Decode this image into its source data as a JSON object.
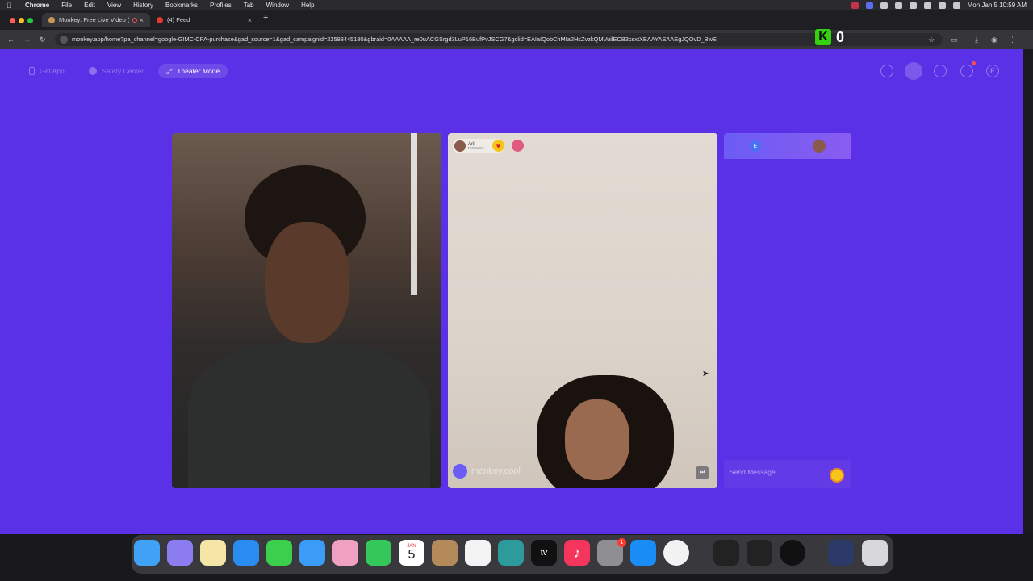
{
  "menubar": {
    "app": "Chrome",
    "items": [
      "File",
      "Edit",
      "View",
      "History",
      "Bookmarks",
      "Profiles",
      "Tab",
      "Window",
      "Help"
    ],
    "datetime": "Mon Jan 5  10:59 AM"
  },
  "tabs": [
    {
      "title": "Monkey: Free Live Video (",
      "active": true
    },
    {
      "title": "(4) Feed",
      "active": false
    }
  ],
  "address": {
    "url": "monkey.app/home?pa_channel=google-GIMC-CPA-purchase&gad_source=1&gad_campaignid=22588445180&gbraid=0AAAAA_re0uACGSrgd3LuP16BufPvJSCG7&gclid=EAIaIQobChMIa2HsZvzkQMVuilECB3csxtXEAAYASAAEgJQOvD_BwE"
  },
  "overlay": {
    "score": "0",
    "logo": "K"
  },
  "page": {
    "get_app": "Get App",
    "safety_center": "Safety Center",
    "theater_mode": "Theater Mode",
    "profile_initial": "E"
  },
  "remote": {
    "username": "Arii",
    "subtitle": "Nickname",
    "watermark": "monkey.cool"
  },
  "chat": {
    "self_initial": "E",
    "placeholder": "Send Message"
  },
  "dock": {
    "calendar_month": "JAN",
    "calendar_day": "5",
    "tv_label": "tv",
    "settings_badge": "1"
  },
  "colors": {
    "page_bg": "#5a31e6",
    "chat_head": "#6b5cf5",
    "accent_yellow": "#f5c518",
    "overlay_green": "#33d10f"
  }
}
